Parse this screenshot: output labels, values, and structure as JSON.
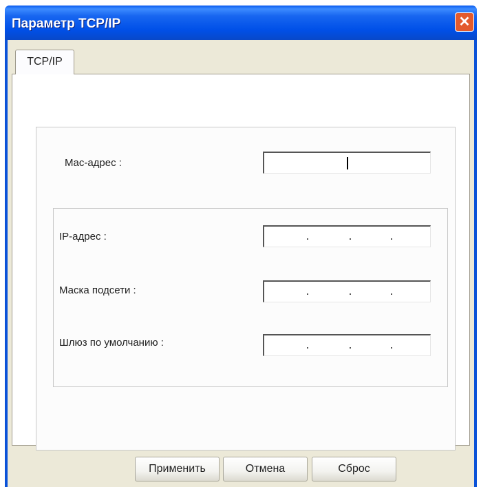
{
  "window": {
    "title": "Параметр TCP/IP"
  },
  "tabs": [
    {
      "label": "TCP/IP",
      "active": true
    }
  ],
  "fields": {
    "mac": {
      "label": "Mac-адрес :",
      "value": ""
    },
    "ip": {
      "label": "IP-адрес :",
      "value": ".   .   ."
    },
    "mask": {
      "label": "Маска подсети :",
      "value": ".   .   ."
    },
    "gateway": {
      "label": "Шлюз по умолчанию :",
      "value": ".   .   ."
    }
  },
  "buttons": {
    "apply": "Применить",
    "cancel": "Отмена",
    "reset": "Сброс"
  },
  "icons": {
    "close": "close-icon"
  },
  "colors": {
    "titlebar": "#0a5cf0",
    "close": "#e35a2d",
    "dialog_bg": "#ece9d8"
  }
}
